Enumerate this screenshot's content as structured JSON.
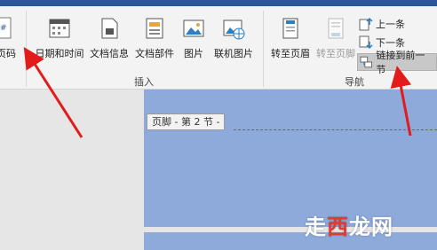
{
  "ribbon": {
    "buttons": {
      "page_number": "页码",
      "datetime": "日期和时间",
      "docinfo": "文档信息",
      "docparts": "文档部件",
      "picture": "图片",
      "online_picture": "联机图片",
      "goto_header": "转至页眉",
      "goto_footer": "转至页脚",
      "previous": "上一条",
      "next": "下一条",
      "link_previous": "链接到前一节"
    },
    "groups": {
      "insert": "插入",
      "navigation": "导航"
    }
  },
  "document": {
    "footer_label": "页脚 - 第 2 节 -"
  },
  "watermark": {
    "part1": "走",
    "part2": "西",
    "part3": "龙网"
  },
  "colors": {
    "title_bar": "#2b579a",
    "page": "#8eaadb",
    "arrow": "#e31b1b"
  }
}
